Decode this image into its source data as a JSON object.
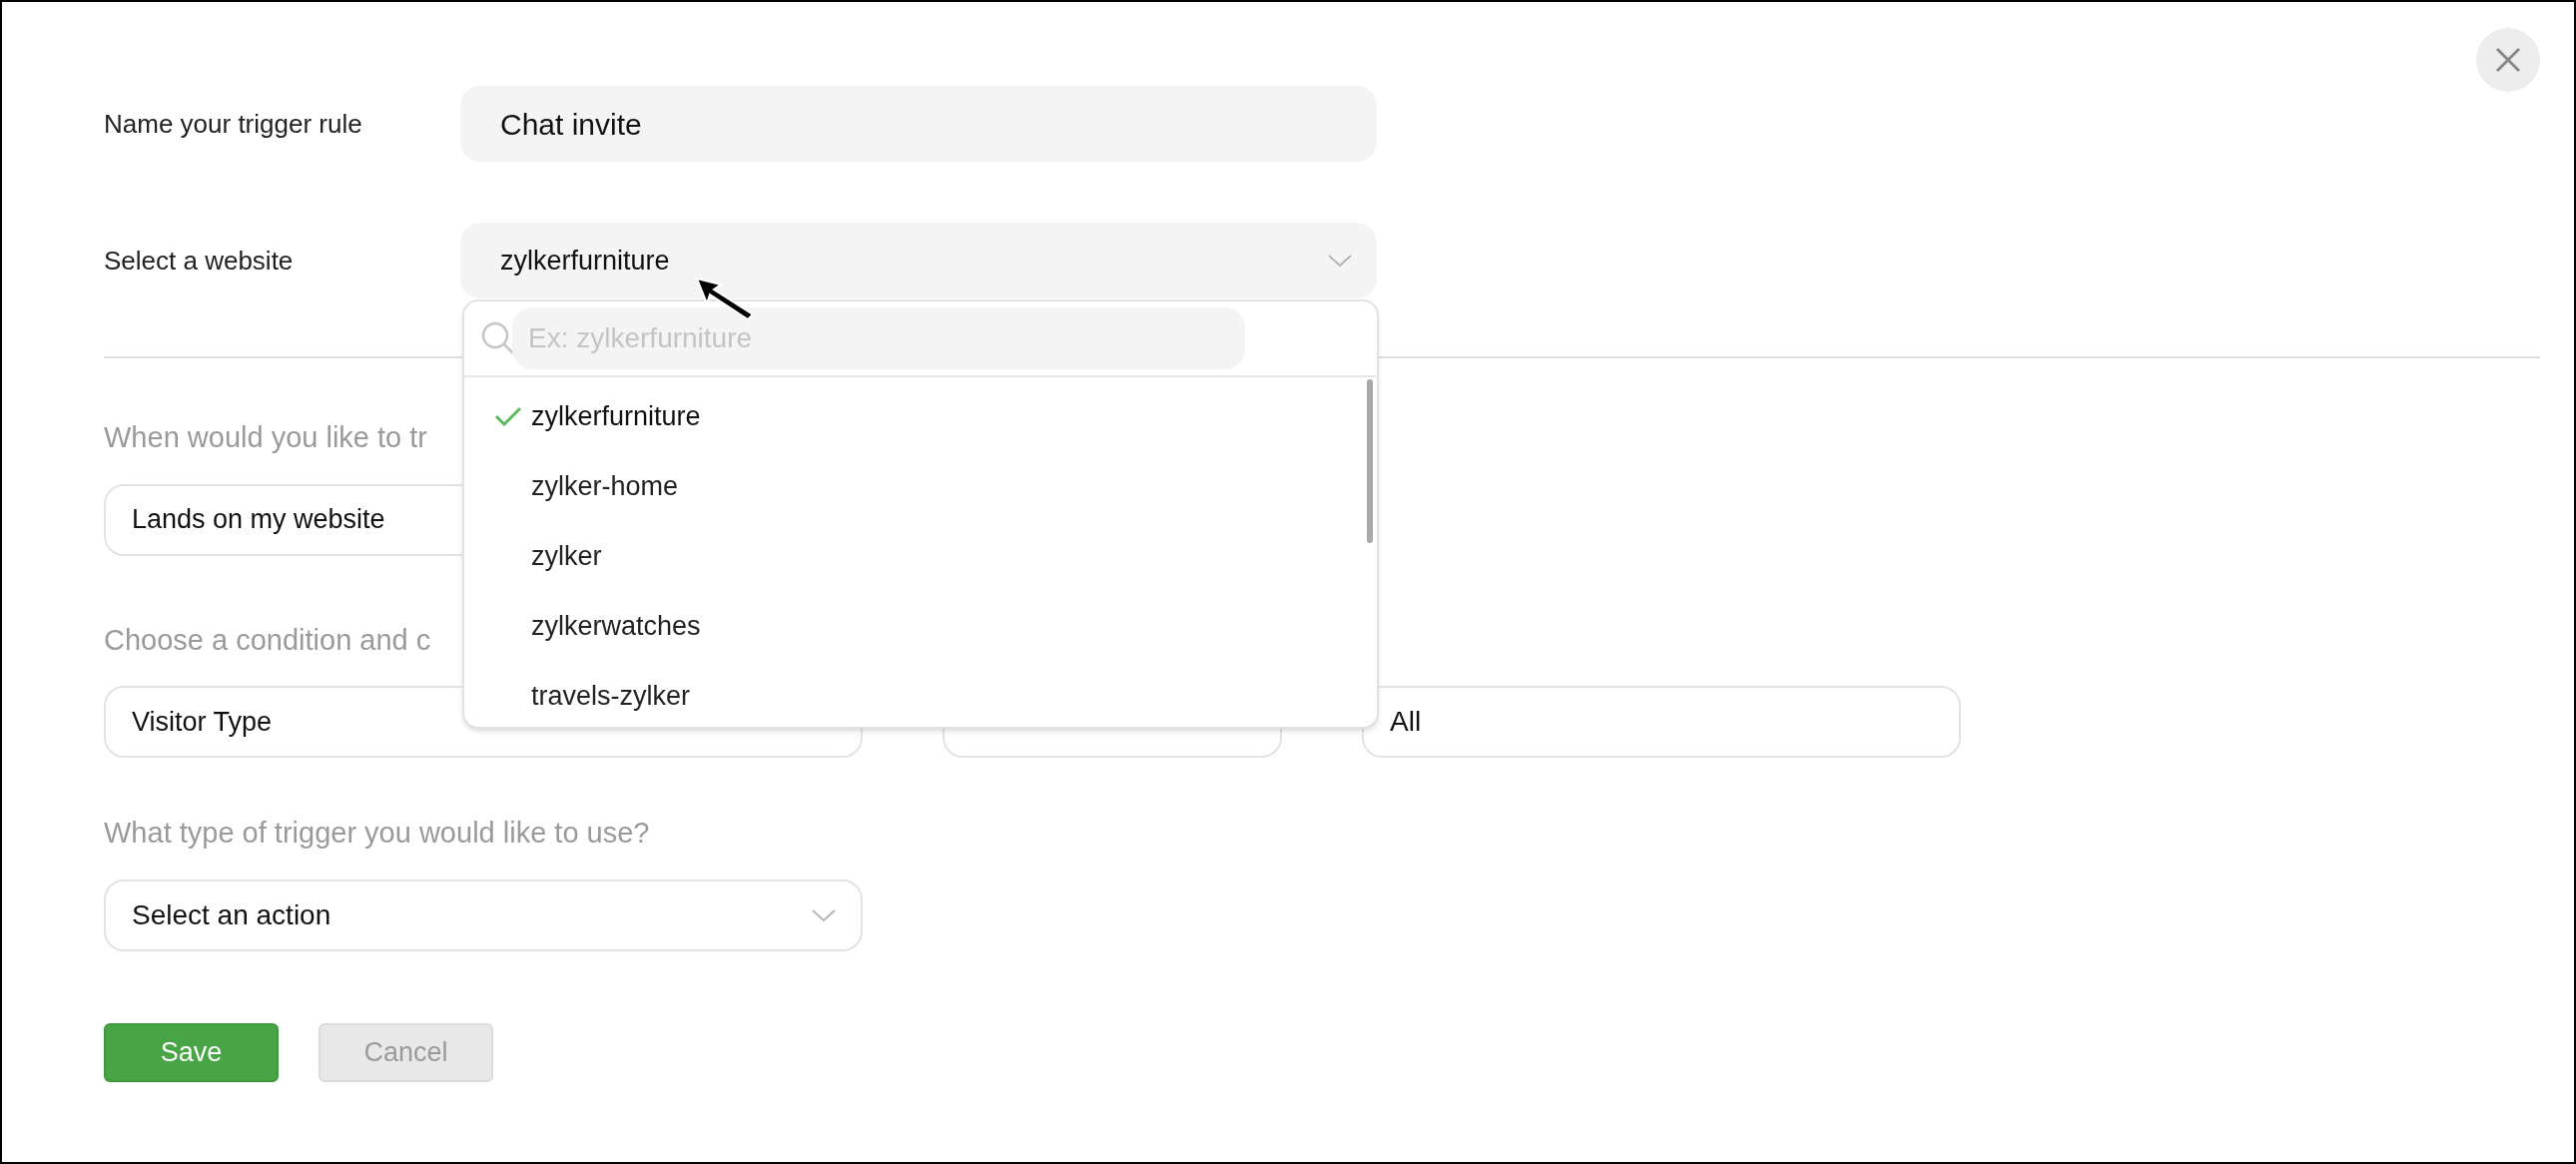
{
  "name_rule": {
    "label": "Name your trigger rule",
    "value": "Chat invite"
  },
  "website": {
    "label": "Select a website",
    "value": "zylkerfurniture"
  },
  "website_dropdown": {
    "search_placeholder": "Ex: zylkerfurniture",
    "options": [
      {
        "label": "zylkerfurniture",
        "selected": true
      },
      {
        "label": "zylker-home",
        "selected": false
      },
      {
        "label": "zylker",
        "selected": false
      },
      {
        "label": "zylkerwatches",
        "selected": false
      },
      {
        "label": "travels-zylker",
        "selected": false
      }
    ]
  },
  "when": {
    "heading": "When would you like to tr",
    "value": "Lands on my website"
  },
  "condition": {
    "heading": "Choose a condition and c",
    "field": "Visitor Type",
    "value": "All"
  },
  "trigger_type": {
    "heading": "What type of trigger you would like to use?",
    "placeholder": "Select an action"
  },
  "buttons": [
    {
      "label": "Save",
      "kind": "primary"
    },
    {
      "label": "Cancel",
      "kind": "secondary"
    }
  ]
}
